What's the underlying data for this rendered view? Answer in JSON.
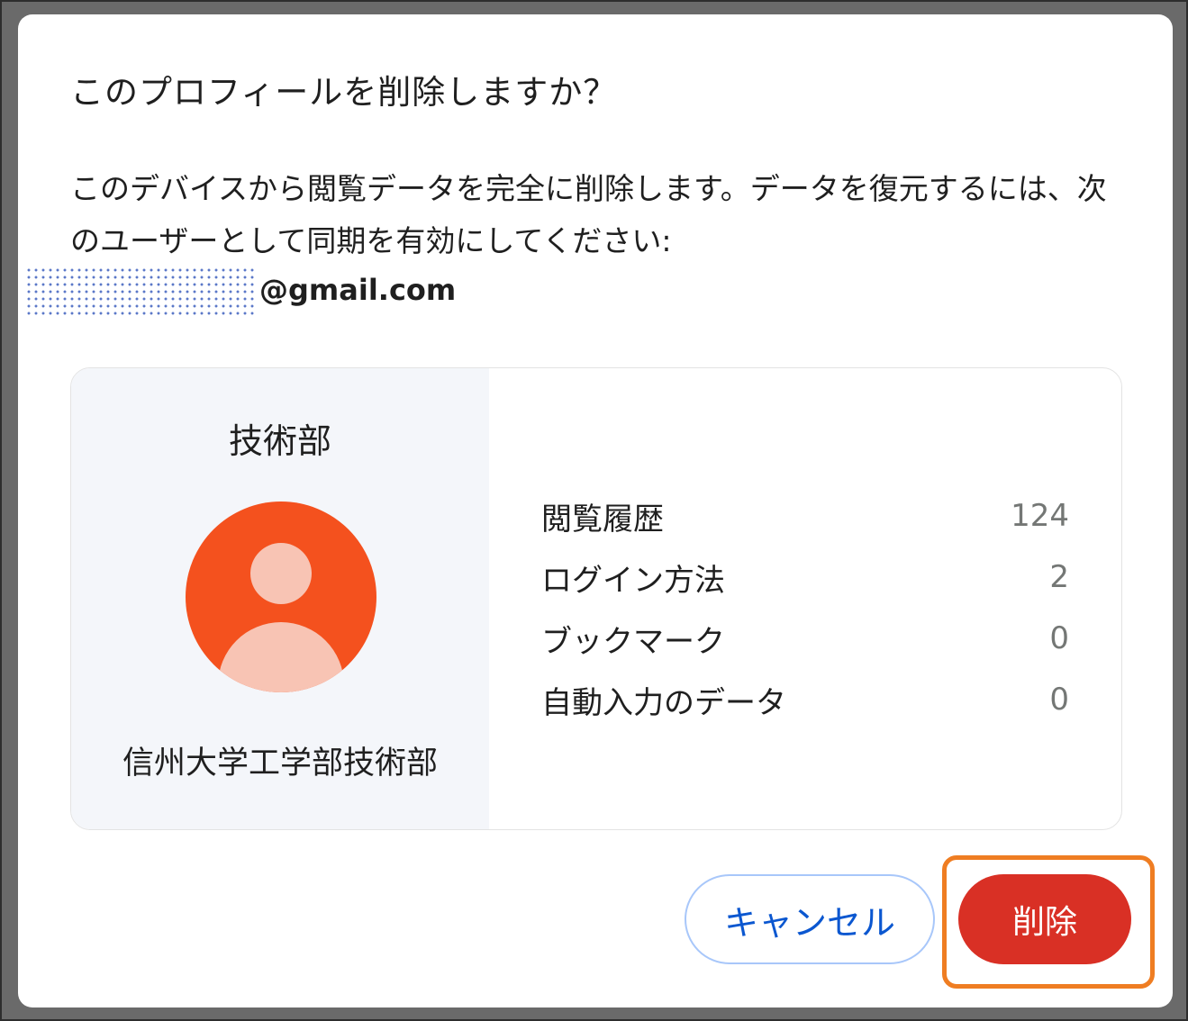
{
  "dialog": {
    "title": "このプロフィールを削除しますか？",
    "description": "このデバイスから閲覧データを完全に削除します。データを復元するには、次のユーザーとして同期を有効にしてください:",
    "email_domain": "@gmail.com"
  },
  "profile": {
    "name": "技術部",
    "organization": "信州大学工学部技術部",
    "avatar_color": "#f4511e",
    "avatar_icon": "person-icon"
  },
  "stats": [
    {
      "label": "閲覧履歴",
      "value": "124"
    },
    {
      "label": "ログイン方法",
      "value": "2"
    },
    {
      "label": "ブックマーク",
      "value": "0"
    },
    {
      "label": "自動入力のデータ",
      "value": "0"
    }
  ],
  "buttons": {
    "cancel_label": "キャンセル",
    "delete_label": "削除"
  },
  "colors": {
    "accent": "#0b57d0",
    "danger": "#d93025",
    "highlight": "#ef7d22"
  }
}
